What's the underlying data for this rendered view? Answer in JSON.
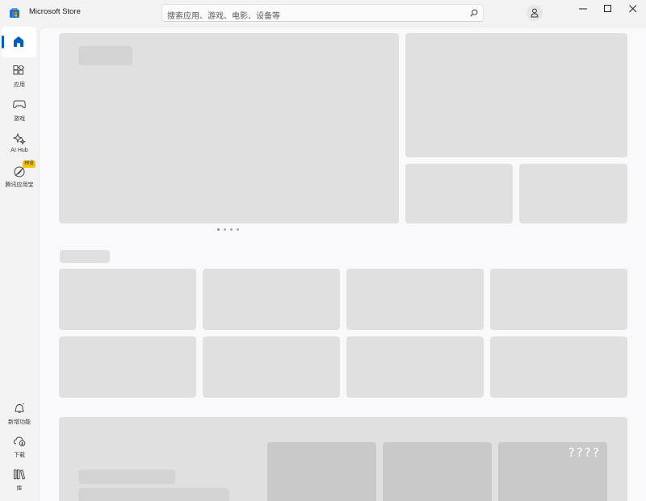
{
  "app": {
    "title": "Microsoft Store"
  },
  "search": {
    "placeholder": "搜索应用、游戏、电影、设备等"
  },
  "sidebar": {
    "items": [
      {
        "label": "应用",
        "icon": "apps-icon"
      },
      {
        "label": "游戏",
        "icon": "gamepad-icon"
      },
      {
        "label": "AI Hub",
        "icon": "sparkle-icon"
      },
      {
        "label": "腾讯应用宝",
        "icon": "android-icon",
        "badge": "预览"
      }
    ],
    "bottom_items": [
      {
        "label": "新增功能",
        "icon": "bell-icon"
      },
      {
        "label": "下载",
        "icon": "cloud-download-icon"
      },
      {
        "label": "库",
        "icon": "library-icon"
      }
    ]
  },
  "content": {
    "tile_overlay_text": "????"
  },
  "colors": {
    "accent": "#005fb8",
    "placeholder": "#e0e0e0",
    "badge": "#f5c518"
  }
}
